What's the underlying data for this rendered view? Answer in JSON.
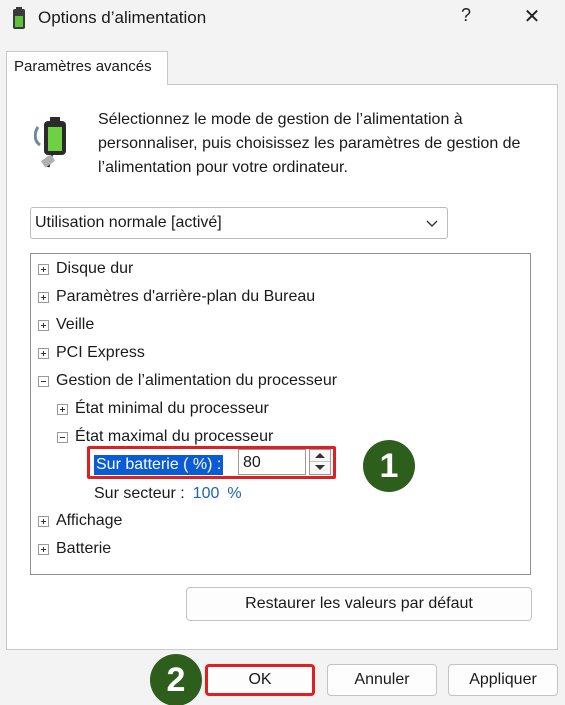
{
  "window": {
    "title": "Options d’alimentation",
    "help": "?",
    "close": "✕"
  },
  "tab": {
    "label": "Paramètres avancés"
  },
  "description": "Sélectionnez le mode de gestion de l’alimentation à personnaliser, puis choisissez les paramètres de gestion de l’alimentation pour votre ordinateur.",
  "plan": {
    "selected": "Utilisation normale [activé]"
  },
  "tree": {
    "items": [
      {
        "label": "Disque dur"
      },
      {
        "label": "Paramètres d'arrière-plan du Bureau"
      },
      {
        "label": "Veille"
      },
      {
        "label": "PCI Express"
      },
      {
        "label": "Gestion de l’alimentation du processeur"
      },
      {
        "label": "État minimal du processeur"
      },
      {
        "label": "État maximal du processeur"
      },
      {
        "label": "Affichage"
      },
      {
        "label": "Batterie"
      }
    ],
    "battery_setting": {
      "label": "Sur batterie ( %) :",
      "value": "80"
    },
    "ac_setting": {
      "label": "Sur secteur :",
      "value": "100",
      "unit": "%"
    }
  },
  "buttons": {
    "restore": "Restaurer les valeurs par défaut",
    "ok": "OK",
    "cancel": "Annuler",
    "apply": "Appliquer"
  },
  "badges": {
    "one": "1",
    "two": "2"
  },
  "colors": {
    "highlight_red": "#e02020",
    "badge_green": "#2e5e1c",
    "selection_blue": "#0a5bd6",
    "value_blue": "#1d63b6"
  }
}
